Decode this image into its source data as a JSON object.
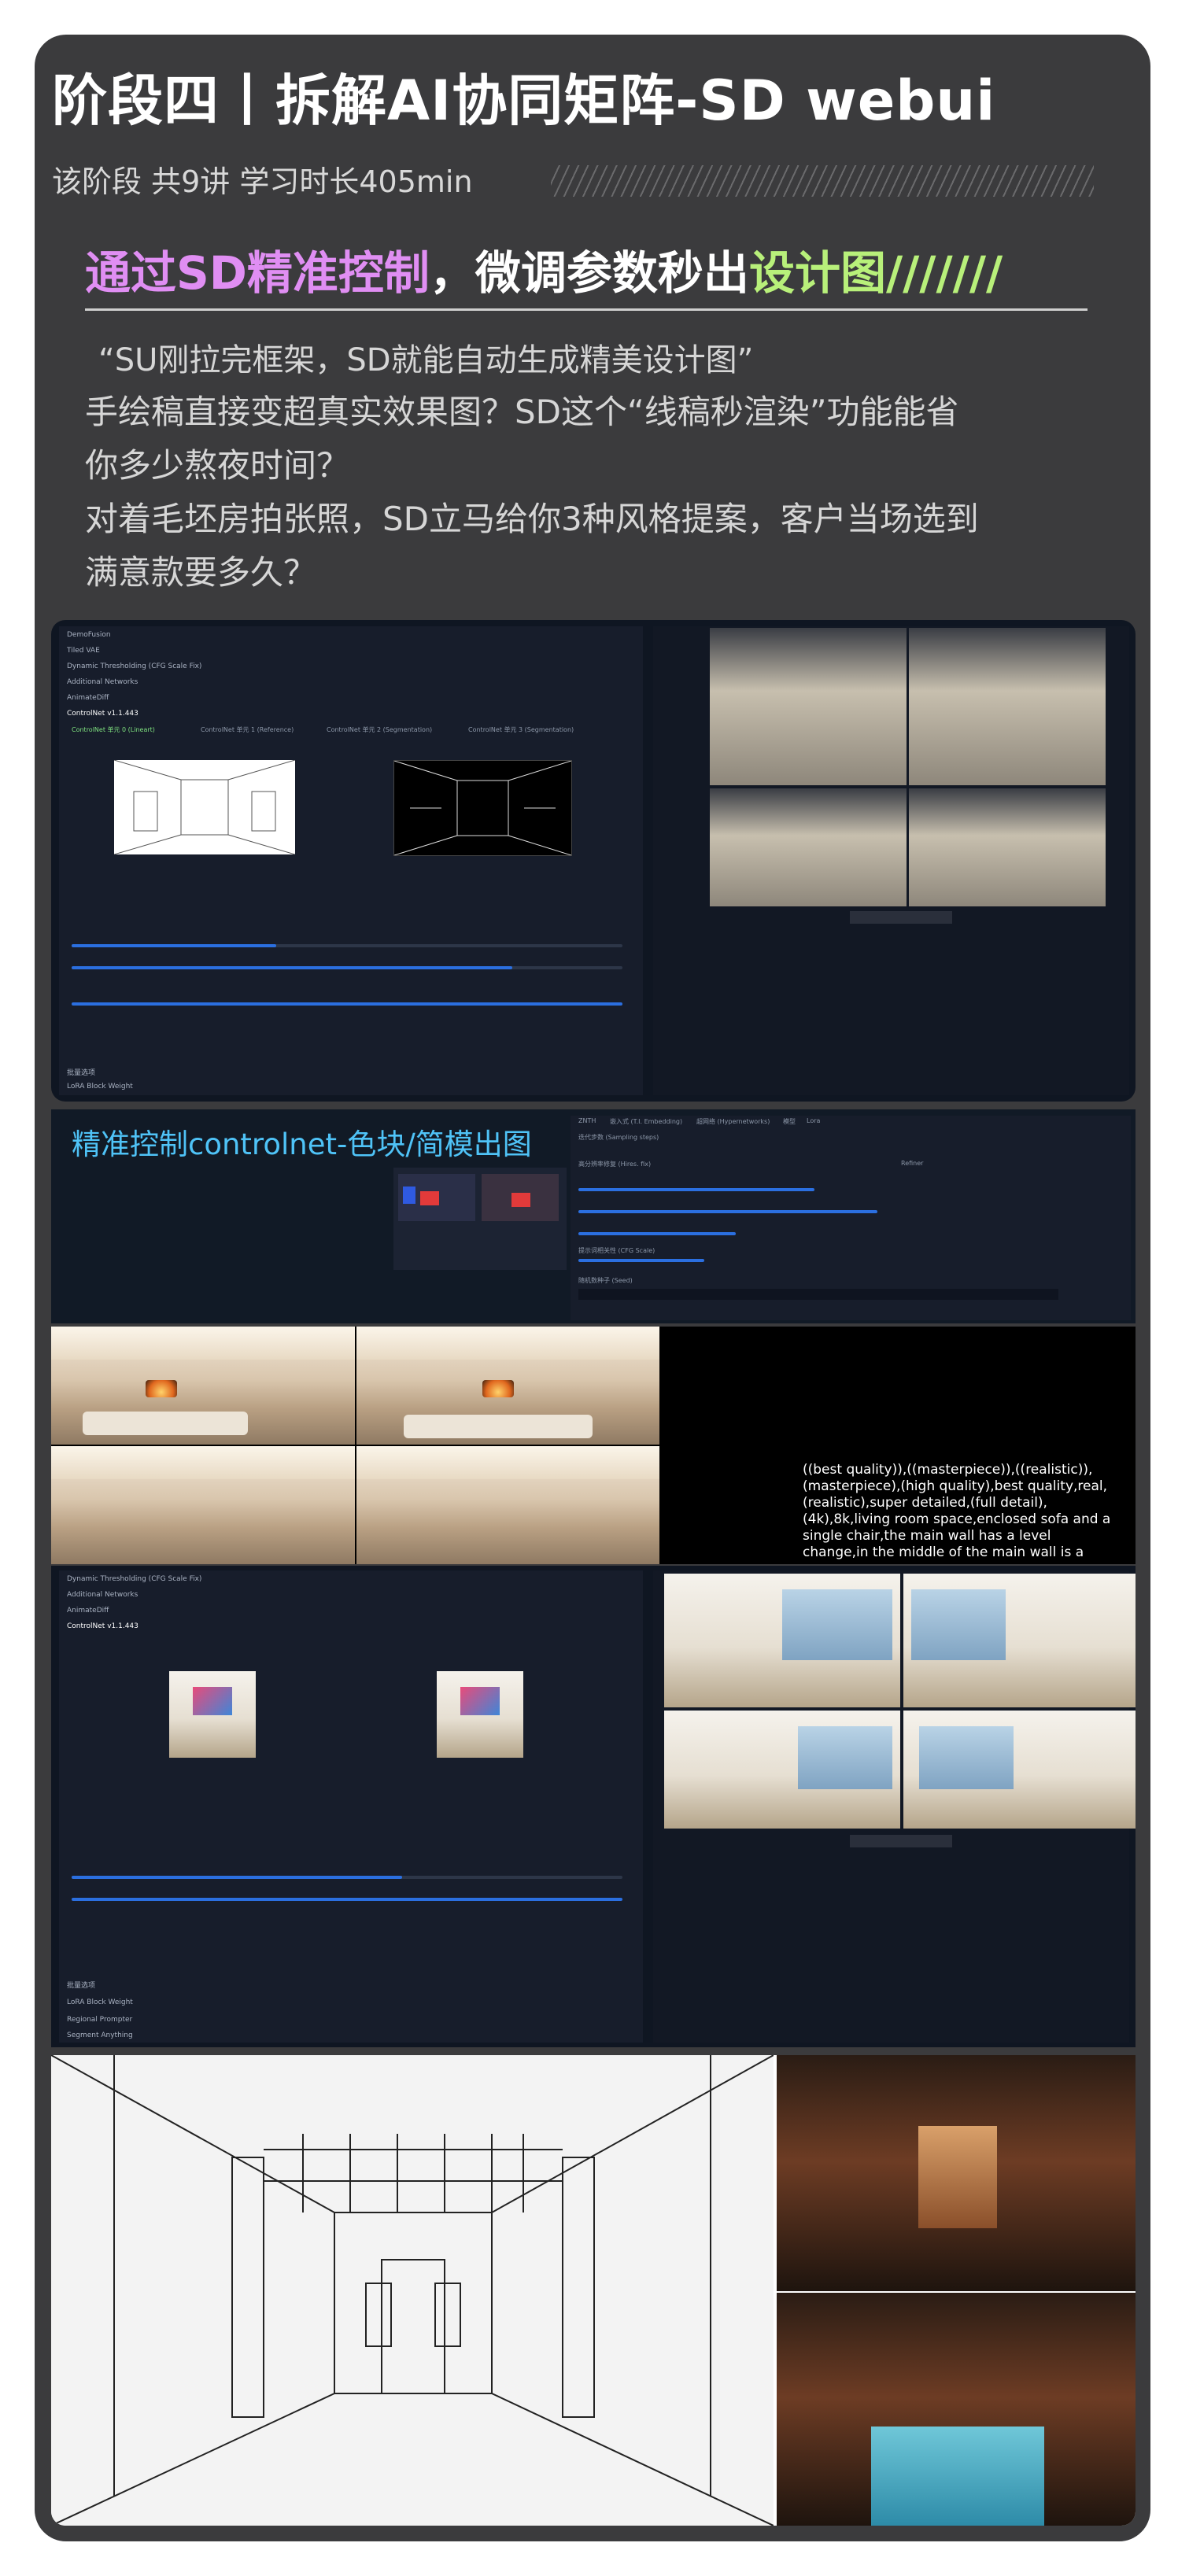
{
  "header": {
    "title": "阶段四丨拆解AI协同矩阵-SD webui",
    "subtitle": "该阶段 共9讲 学习时长405min"
  },
  "headline": {
    "part1": "通过SD精准控制",
    "part2": "，微调参数秒出",
    "part3": "设计图///////"
  },
  "paragraphs": [
    "“SU刚拉完框架，SD就能自动生成精美设计图”",
    "手绘稿直接变超真实效果图？SD这个“线稿秒渲染”功能能省",
    "你多少熬夜时间？",
    "对着毛坯房拍张照，SD立马给你3种风格提案，客户当场选到",
    "满意款要多久？"
  ],
  "section_label": "精准控制controlnet-色块/简模出图",
  "prompt_text": "((best quality)),((masterpiece)),((realistic)),(masterpiece),(high quality),best quality,real,(realistic),super detailed,(full detail),(4k),8k,living room space,enclosed sofa and a single chair,the main wall has a level change,in the middle of the main wall is a fireplace to set off the",
  "ui1": {
    "rows": [
      "DemoFusion",
      "Tiled VAE",
      "Dynamic Thresholding (CFG Scale Fix)",
      "Additional Networks",
      "AnimateDiff",
      "ControlNet v1.1.443"
    ],
    "tabs": [
      "ControlNet 单元 0 (Lineart)",
      "ControlNet 单元 1 (Reference)",
      "ControlNet 单元 2 (Segmentation)",
      "ControlNet 单元 3 (Segmentation)"
    ],
    "bottom_rows": [
      "批量选项",
      "LoRA Block Weight"
    ]
  },
  "ui2": {
    "tabs": [
      "ZNTH",
      "嵌入式 (T.I. Embedding)",
      "超网络 (Hypernetworks)",
      "模型",
      "Lora"
    ],
    "fields": [
      "迭代步数 (Sampling steps)",
      "高分辨率修复 (Hires. fix)",
      "Refiner",
      "提示词相关性 (CFG Scale)",
      "随机数种子 (Seed)"
    ]
  },
  "ui3": {
    "rows": [
      "Dynamic Thresholding (CFG Scale Fix)",
      "Additional Networks",
      "AnimateDiff",
      "ControlNet v1.1.443"
    ],
    "bottom_rows": [
      "批量选项",
      "LoRA Block Weight",
      "Regional Prompter",
      "Segment Anything"
    ]
  },
  "colors": {
    "card_bg": "#3b3b3d",
    "accent_pink": "#e08ef3",
    "accent_green": "#b8f07a",
    "ui_blue": "#2b6fe0",
    "label_cyan": "#4fc3f7"
  }
}
